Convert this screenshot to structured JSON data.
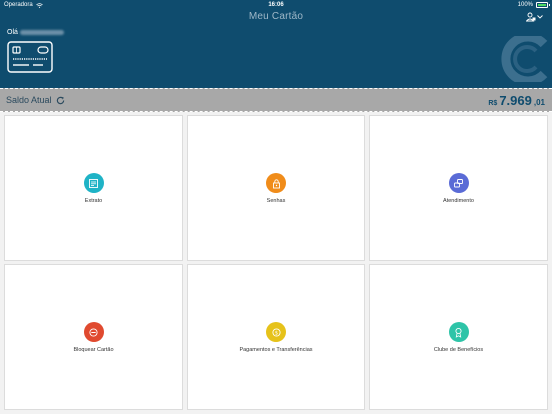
{
  "status_bar": {
    "carrier": "Operadora",
    "time": "16:06",
    "battery": "100%"
  },
  "header": {
    "title": "Meu Cartão",
    "greeting": "Olá"
  },
  "balance": {
    "label": "Saldo Atual",
    "currency": "R$",
    "integer": "7.969",
    "decimal": ",01"
  },
  "tiles": [
    {
      "label": "Extrato",
      "icon": "statement-icon",
      "color": "#1fb3c6"
    },
    {
      "label": "Senhas",
      "icon": "lock-icon",
      "color": "#f08c1a"
    },
    {
      "label": "Atendimento",
      "icon": "chat-icon",
      "color": "#5a6bd6"
    },
    {
      "label": "Bloquear Cartão",
      "icon": "block-icon",
      "color": "#e04a2f"
    },
    {
      "label": "Pagamentos e Transferências",
      "icon": "coin-icon",
      "color": "#e6c21a"
    },
    {
      "label": "Clube de Benefícios",
      "icon": "award-icon",
      "color": "#2ec4a8"
    }
  ],
  "colors": {
    "header_bg": "#0f4c6e",
    "balance_bg": "#a8a8a8"
  }
}
